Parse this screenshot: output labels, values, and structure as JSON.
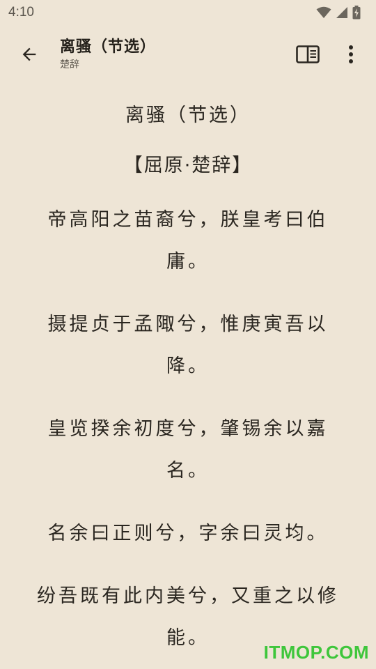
{
  "status_bar": {
    "time": "4:10",
    "icons": [
      "wifi-icon",
      "cellular-signal-icon",
      "battery-charging-icon"
    ]
  },
  "app_bar": {
    "back_icon": "arrow-back-icon",
    "title": "离骚（节选）",
    "subtitle": "楚辞",
    "reader_icon": "reader-mode-icon",
    "more_icon": "more-vert-icon"
  },
  "poem": {
    "title": "离骚（节选）",
    "author": "【屈原·楚辞】",
    "lines": [
      "帝高阳之苗裔兮，朕皇考曰伯庸。",
      "摄提贞于孟陬兮，惟庚寅吾以降。",
      "皇览揆余初度兮，肇锡余以嘉名。",
      "名余曰正则兮，字余曰灵均。",
      "纷吾既有此内美兮，又重之以修能。"
    ]
  },
  "watermark": "ITMOP.COM",
  "colors": {
    "background": "#eee5d6",
    "text": "#2a2620",
    "watermark": "#3ec63b"
  }
}
